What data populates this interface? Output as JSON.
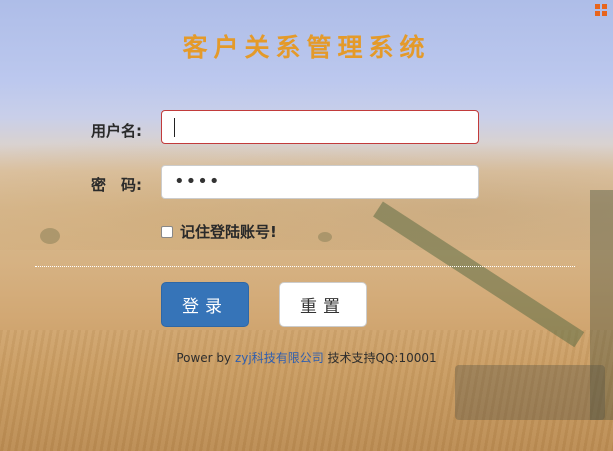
{
  "app": {
    "title": "客户关系管理系统"
  },
  "form": {
    "username_label": "用户名:",
    "username_value": "",
    "password_label": "密　码:",
    "password_mask": "••••",
    "remember_label": "记住登陆账号!",
    "remember_checked": false
  },
  "buttons": {
    "login": "登录",
    "reset": "重置"
  },
  "footer": {
    "prefix": "Power by ",
    "company": "zyj科技有限公司",
    "support": " 技术支持QQ:10001"
  },
  "icons": {
    "top_right": "windows-icon"
  },
  "colors": {
    "title": "#e49a2a",
    "login_button": "#3674b8",
    "focus_border": "#c23b3b",
    "link": "#2f5fb0",
    "window_icon": "#e8641c"
  }
}
